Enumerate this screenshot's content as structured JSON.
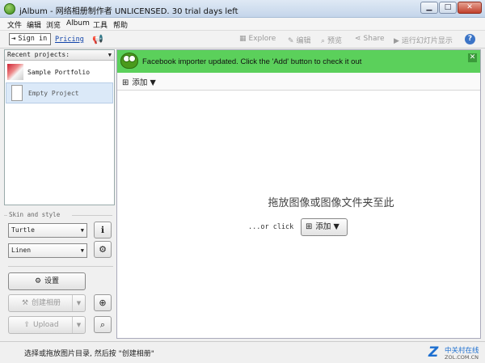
{
  "window": {
    "title": "jAlbum - 网络相册制作者 UNLICENSED. 30 trial days left",
    "controls": {
      "minimize": "▁",
      "maximize": "□",
      "close": "✕"
    }
  },
  "menu": [
    "文件",
    "编辑",
    "浏览",
    "Album",
    "工具",
    "帮助"
  ],
  "toolbar": {
    "sign_in": "Sign in",
    "pricing": "Pricing",
    "explore": "Explore",
    "edit": "编辑",
    "preview": "预览",
    "share": "Share",
    "slideshow": "运行幻灯片显示"
  },
  "sidebar": {
    "recent_header": "Recent projects:",
    "projects": [
      {
        "label": "Sample Portfolio",
        "selected": false
      },
      {
        "label": "Empty Project",
        "selected": true
      }
    ],
    "skin_label": "Skin and style",
    "skin_value": "Turtle",
    "style_value": "Linen",
    "settings_label": "设置",
    "create_album_label": "创建相册",
    "upload_label": "Upload"
  },
  "main": {
    "notification": "Facebook importer updated. Click the 'Add' button to check it out",
    "add_label": "添加",
    "drop_text": "拖放图像或图像文件夹至此",
    "or_click": "...or click",
    "add_button_label": "添加"
  },
  "status": {
    "text": "选择或拖放图片目录, 然后按 \"创建相册\""
  },
  "watermark": {
    "brand": "中关村在线",
    "url": "ZOL.COM.CN"
  },
  "icons": {
    "app": "jalbum-frog-icon",
    "sign_in": "login-arrow-icon",
    "megaphone": "megaphone-icon",
    "explore": "grid-icon",
    "edit": "pencil-icon",
    "preview": "magnifier-icon",
    "share": "share-icon",
    "slideshow": "play-icon",
    "help": "help-icon",
    "settings": "gear-icon",
    "info": "info-icon",
    "zoom": "zoom-in-icon",
    "search": "search-icon",
    "add": "add-image-icon"
  },
  "colors": {
    "notification_bg": "#5bd05b",
    "selection_bg": "#dbe9f8",
    "link": "#1144aa",
    "watermark": "#1d6fd0"
  }
}
